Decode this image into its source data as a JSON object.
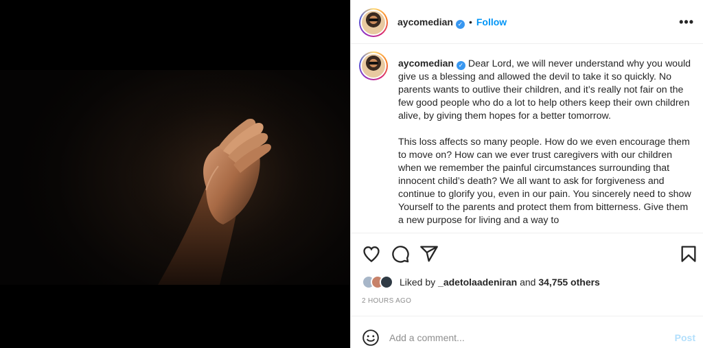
{
  "post": {
    "username": "aycomedian",
    "verified_mark": "✓",
    "separator": "•",
    "follow_label": "Follow",
    "more_label": "•••",
    "caption_paragraphs": [
      "Dear Lord, we will never understand why you would give us a blessing and allowed the devil to take it so quickly. No parents wants to outlive their children, and it’s really not fair on the few good people who do a lot to help others keep their own children alive, by giving them hopes for a better tomorrow.",
      "This loss affects so many people. How do we even encourage them to move on? How can we ever trust caregivers with our children when we remember the painful circumstances surrounding that innocent child’s death? We all want to ask for forgiveness and continue to glorify you, even in our pain. You sincerely need to show Yourself to the parents and protect them from bitterness. Give them a new purpose for living and a way to"
    ],
    "likes": {
      "prefix": "Liked by ",
      "user": "_adetolaadeniran",
      "conjunction": " and ",
      "others": "34,755 others"
    },
    "timestamp": "2 HOURS AGO",
    "comment_placeholder": "Add a comment...",
    "post_label": "Post"
  },
  "icons": {
    "like": "heart-icon",
    "comment": "comment-icon",
    "share": "share-icon",
    "save": "bookmark-icon",
    "emoji": "emoji-icon"
  },
  "colors": {
    "link_blue": "#0095f6",
    "post_disabled": "#b2dffc",
    "muted_text": "#8e8e8e"
  }
}
